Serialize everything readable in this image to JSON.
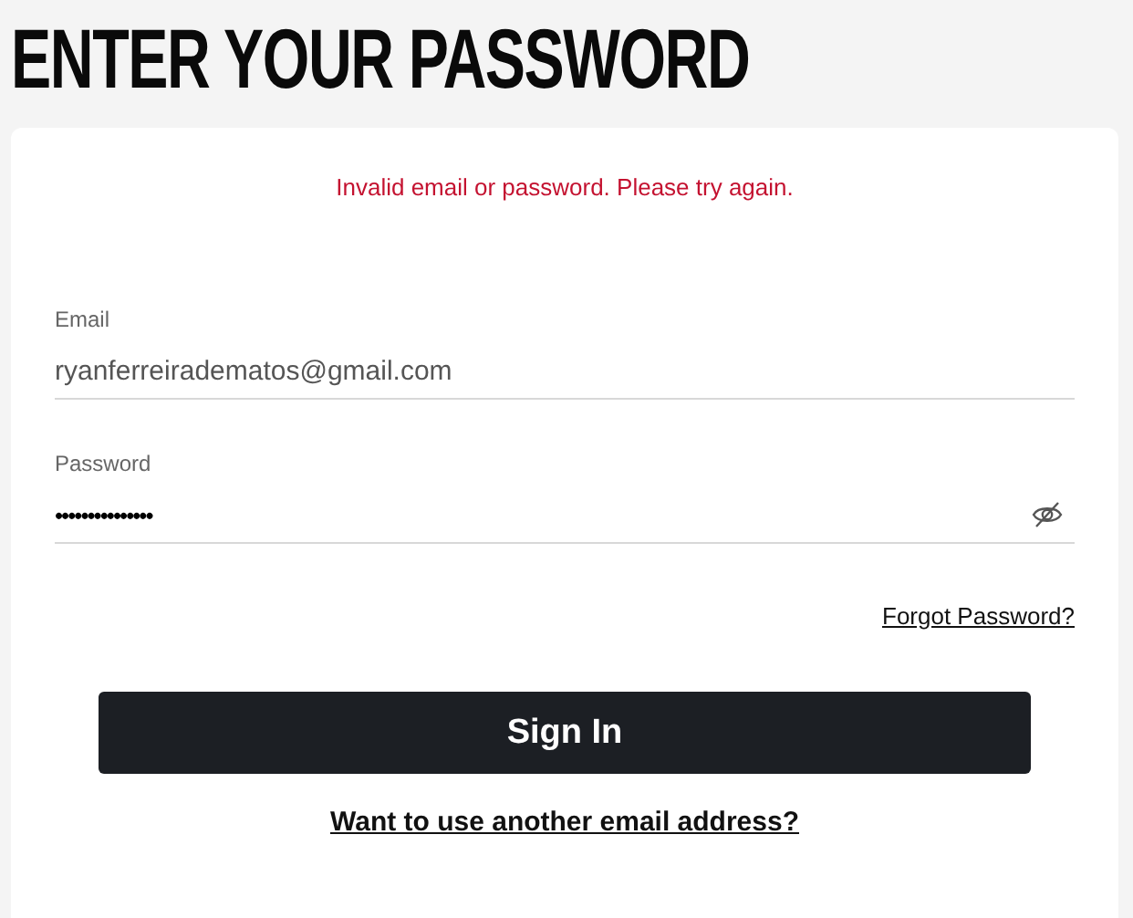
{
  "title": "ENTER YOUR PASSWORD",
  "error": "Invalid email or password. Please try again.",
  "fields": [
    {
      "label": "Email",
      "value": "ryanferreiradematos@gmail.com",
      "kind": "text"
    },
    {
      "label": "Password",
      "value": "•••••••••••••••",
      "kind": "password"
    }
  ],
  "forgot_link": "Forgot Password?",
  "sign_in_button": "Sign In",
  "other_email_link": "Want to use another email address?"
}
